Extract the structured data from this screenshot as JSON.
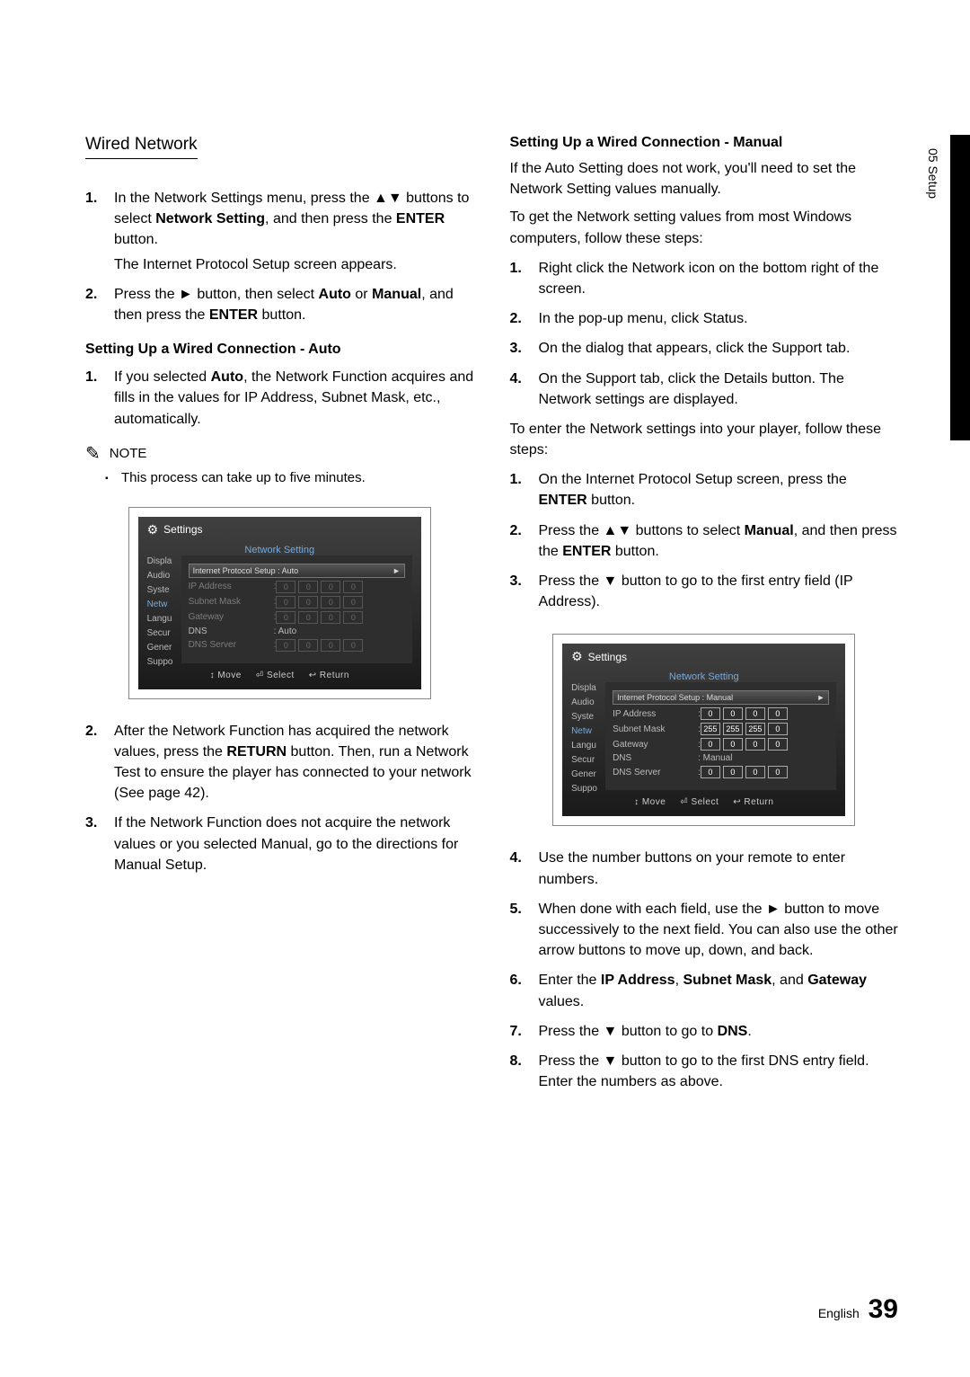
{
  "edge_tab": "05  Setup",
  "footer": {
    "lang": "English",
    "page": "39"
  },
  "left": {
    "heading": "Wired Network",
    "step1_a": "In the Network Settings menu, press the ▲▼ buttons to select ",
    "step1_b": "Network Setting",
    "step1_c": ", and then press the ",
    "step1_d": "ENTER",
    "step1_e": " button.",
    "step1_cont": "The Internet Protocol Setup screen appears.",
    "step2_a": "Press the ► button, then select ",
    "step2_b": "Auto",
    "step2_c": " or ",
    "step2_d": "Manual",
    "step2_e": ", and then press the ",
    "step2_f": "ENTER",
    "step2_g": " button.",
    "sub_auto": "Setting Up a Wired Connection - Auto",
    "auto1_a": "If you selected ",
    "auto1_b": "Auto",
    "auto1_c": ", the Network Function acquires and fills in the values for IP Address, Subnet Mask, etc., automatically.",
    "note_label": "NOTE",
    "note_body": "This process can take up to five minutes.",
    "after2_a": "After the Network Function has acquired the network values, press the ",
    "after2_b": "RETURN",
    "after2_c": " button. Then, run a Network Test to ensure the player has connected to your network (See page 42).",
    "after3": "If the Network Function does not acquire the network values or you selected Manual, go to the directions for Manual Setup."
  },
  "right": {
    "sub_manual": "Setting Up a Wired Connection - Manual",
    "intro1": "If the Auto Setting does not work, you'll need to set the Network Setting values manually.",
    "intro2": "To get the Network setting values from most Windows computers, follow these steps:",
    "w1": "Right click the Network icon on the bottom right of the screen.",
    "w2": "In the pop-up menu, click Status.",
    "w3": "On the dialog that appears, click the Support tab.",
    "w4": "On the Support tab, click the Details button. The Network settings are displayed.",
    "mid": "To enter the Network settings into your player, follow these steps:",
    "p1_a": "On the Internet Protocol Setup screen, press the ",
    "p1_b": "ENTER",
    "p1_c": " button.",
    "p2_a": "Press the ▲▼ buttons to select ",
    "p2_b": "Manual",
    "p2_c": ", and then press the ",
    "p2_d": "ENTER",
    "p2_e": " button.",
    "p3": "Press the ▼ button to go to the first entry field (IP Address).",
    "p4": "Use the number buttons on your remote to enter numbers.",
    "p5": "When done with each field, use the ► button to move successively to the next field. You can also use the other arrow buttons to move up, down, and back.",
    "p6_a": "Enter the ",
    "p6_b": "IP Address",
    "p6_c": ", ",
    "p6_d": "Subnet Mask",
    "p6_e": ", and ",
    "p6_f": "Gateway",
    "p6_g": " values.",
    "p7_a": "Press the ▼ button to go to ",
    "p7_b": "DNS",
    "p7_c": ".",
    "p8": "Press the ▼ button to go to the first DNS entry field. Enter the numbers as above."
  },
  "shot_common": {
    "settings": "Settings",
    "panel_title": "Network Setting",
    "side": [
      "Displa",
      "Audio",
      "Syste",
      "Netw",
      "Langu",
      "Secur",
      "Gener",
      "Suppo"
    ],
    "ip": "IP Address",
    "mask": "Subnet Mask",
    "gw": "Gateway",
    "dns": "DNS",
    "dns_srv": "DNS Server",
    "footer": {
      "move": "↕ Move",
      "select": "⏎ Select",
      "return": "↩ Return"
    }
  },
  "shot_auto": {
    "dropdown": "Internet Protocol Setup : Auto",
    "dns_val": ": Auto",
    "cells_ip": [
      "0",
      "0",
      "0",
      "0"
    ],
    "cells_mask": [
      "0",
      "0",
      "0",
      "0"
    ],
    "cells_gw": [
      "0",
      "0",
      "0",
      "0"
    ],
    "cells_dns": [
      "0",
      "0",
      "0",
      "0"
    ]
  },
  "shot_manual": {
    "dropdown": "Internet Protocol Setup : Manual",
    "dns_val": ": Manual",
    "cells_ip": [
      "0",
      "0",
      "0",
      "0"
    ],
    "cells_mask": [
      "255",
      "255",
      "255",
      "0"
    ],
    "cells_gw": [
      "0",
      "0",
      "0",
      "0"
    ],
    "cells_dns": [
      "0",
      "0",
      "0",
      "0"
    ]
  }
}
